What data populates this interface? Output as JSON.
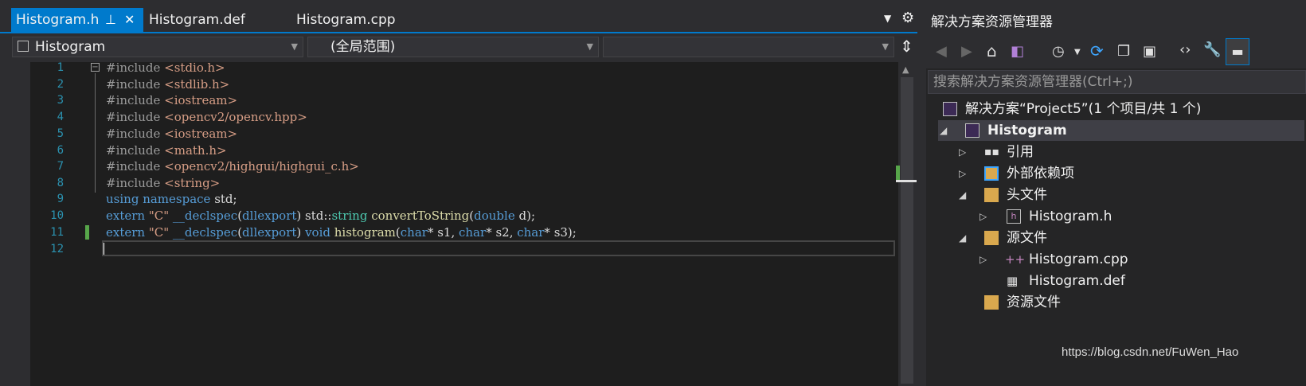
{
  "tabs": [
    {
      "label": "Histogram.h",
      "active": true
    },
    {
      "label": "Histogram.def",
      "active": false
    },
    {
      "label": "Histogram.cpp",
      "active": false
    }
  ],
  "navbar": {
    "project": "Histogram",
    "scope": "(全局范围)",
    "member": ""
  },
  "editor": {
    "line_numbers": [
      "1",
      "2",
      "3",
      "4",
      "5",
      "6",
      "7",
      "8",
      "9",
      "10",
      "11",
      "12"
    ],
    "lines": {
      "l1_kw": "#include",
      "l1_inc": "<stdio.h>",
      "l2_kw": "#include",
      "l2_inc": "<stdlib.h>",
      "l3_kw": "#include",
      "l3_inc": "<iostream>",
      "l4_kw": "#include",
      "l4_inc": "<opencv2/opencv.hpp>",
      "l5_kw": "#include",
      "l5_inc": "<iostream>",
      "l6_kw": "#include",
      "l6_inc": "<math.h>",
      "l7_kw": "#include",
      "l7_inc": "<opencv2/highgui/highgui_c.h>",
      "l8_kw": "#include",
      "l8_inc": "<string>",
      "l9": {
        "using": "using",
        "namespace": "namespace",
        "rest": " std;"
      },
      "l10": {
        "extern": "extern",
        "str": "\"C\"",
        "declspec": "__declspec",
        "paren_open": "(",
        "dllexport": "dllexport",
        "paren_close": ")",
        "std": " std::",
        "string": "string",
        "fn": "convertToString",
        "p1": "(",
        "double": "double",
        "arg": " d);"
      },
      "l11": {
        "extern": "extern",
        "str": "\"C\"",
        "declspec": "__declspec",
        "paren_open": "(",
        "dllexport": "dllexport",
        "paren_close": ")",
        "void": "void",
        "fn": "histogram",
        "p1": "(",
        "char1": "char",
        "a1": "* s1, ",
        "char2": "char",
        "a2": "* s2, ",
        "char3": "char",
        "a3": "* s3);"
      }
    }
  },
  "solution_explorer": {
    "title": "解决方案资源管理器",
    "search_placeholder": "搜索解决方案资源管理器(Ctrl+;)",
    "solution_label": "解决方案“Project5”(1 个项目/共 1 个)",
    "project_label": "Histogram",
    "items": {
      "references": "引用",
      "external_deps": "外部依赖项",
      "header_files": "头文件",
      "histogram_h": "Histogram.h",
      "source_files": "源文件",
      "histogram_cpp": "Histogram.cpp",
      "histogram_def": "Histogram.def",
      "resource_files": "资源文件"
    }
  },
  "watermark": "https://blog.csdn.net/FuWen_Hao",
  "colors": {
    "accent": "#007acc",
    "editor_bg": "#1e1e1e",
    "keyword": "#569cd6",
    "include_string": "#d69d85",
    "line_number": "#2b91af"
  }
}
